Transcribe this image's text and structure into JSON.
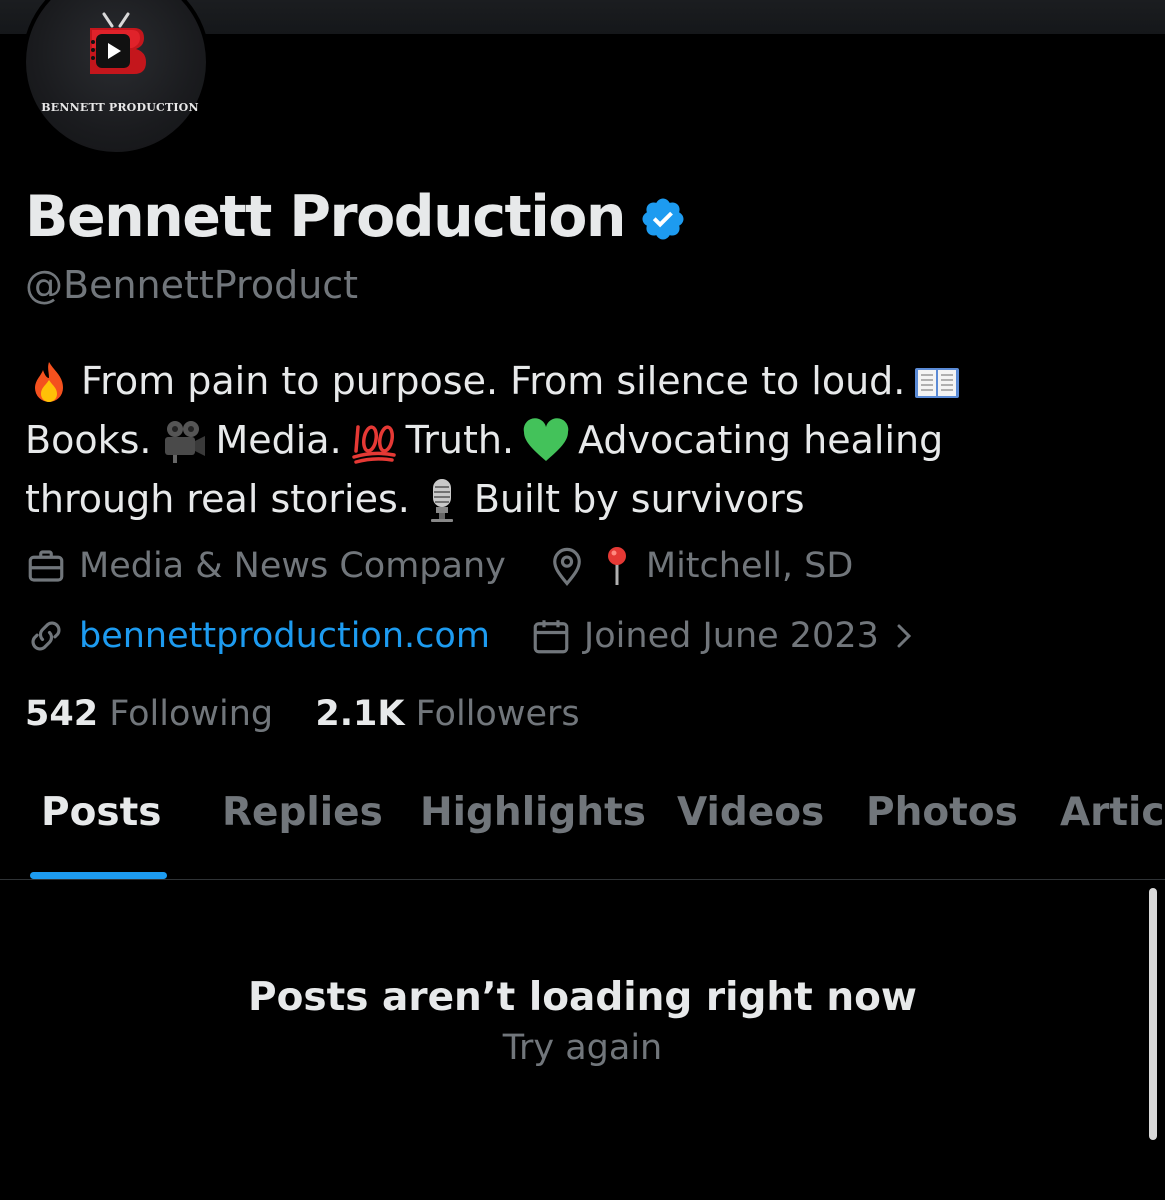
{
  "profile": {
    "logo_text": "BENNETT PRODUCTION",
    "name": "Bennett Production",
    "handle": "@BennettProduct",
    "bio": {
      "line1": "From pain to purpose. From silence to loud.",
      "line2_a": "Books.",
      "line2_b": "Media.",
      "line2_c": "Truth.",
      "line2_d": "Advocating healing",
      "line3_a": "through real stories.",
      "line3_b": "Built by survivors"
    },
    "category": "Media & News Company",
    "location": "Mitchell, SD",
    "website": "bennettproduction.com",
    "joined": "Joined June 2023",
    "following_count": "542",
    "following_label": "Following",
    "followers_count": "2.1K",
    "followers_label": "Followers"
  },
  "tabs": [
    {
      "label": "Posts",
      "active": true
    },
    {
      "label": "Replies"
    },
    {
      "label": "Highlights"
    },
    {
      "label": "Videos"
    },
    {
      "label": "Photos"
    },
    {
      "label": "Articles"
    }
  ],
  "empty_state": {
    "title": "Posts aren’t loading right now",
    "action": "Try again"
  },
  "icons": {
    "verified": "verified-badge-icon",
    "category": "briefcase-icon",
    "location": "location-pin-icon",
    "website": "link-icon",
    "joined": "calendar-icon",
    "chevron": "chevron-right-icon"
  },
  "colors": {
    "background": "#000000",
    "text": "#e7e9ea",
    "muted": "#71767b",
    "accent": "#1d9bf0"
  }
}
